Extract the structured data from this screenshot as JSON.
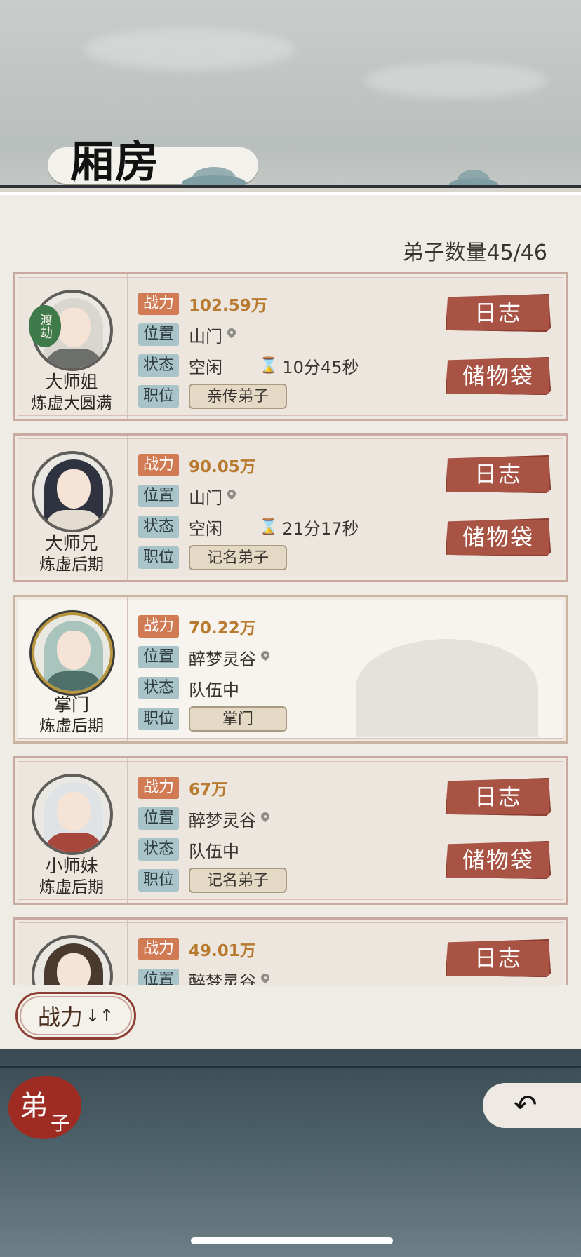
{
  "page_title": "厢房",
  "disciple_count": "弟子数量45/46",
  "labels": {
    "power": "战力",
    "location": "位置",
    "status": "状态",
    "position": "职位",
    "log_button": "日志",
    "bag_button": "储物袋"
  },
  "disciples": [
    {
      "name": "大师姐",
      "realm": "炼虚大圆满",
      "badge": "渡劫",
      "power": "102.59万",
      "location": "山门",
      "status": "空闲",
      "timer": "10分45秒",
      "role": "亲传弟子"
    },
    {
      "name": "大师兄",
      "realm": "炼虚后期",
      "power": "90.05万",
      "location": "山门",
      "status": "空闲",
      "timer": "21分17秒",
      "role": "记名弟子"
    },
    {
      "name": "掌门",
      "realm": "炼虚后期",
      "power": "70.22万",
      "location": "醉梦灵谷",
      "status": "队伍中",
      "role": "掌门"
    },
    {
      "name": "小师妹",
      "realm": "炼虚后期",
      "power": "67万",
      "location": "醉梦灵谷",
      "status": "队伍中",
      "role": "记名弟子"
    },
    {
      "power": "49.01万",
      "location": "醉梦灵谷"
    }
  ],
  "sort_button": {
    "label": "战力",
    "icon": "↓↑"
  },
  "bottom_tab": {
    "char1": "弟",
    "char2": "子"
  },
  "back_icon": "↶",
  "hourglass_icon": "⌛"
}
